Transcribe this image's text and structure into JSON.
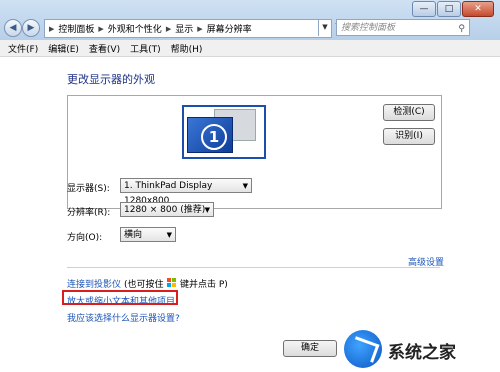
{
  "window": {
    "controls": {
      "minimize": "—",
      "maximize": "□",
      "close": "✕"
    }
  },
  "nav": {
    "back": "◀",
    "forward": "▶"
  },
  "address": {
    "segments": [
      "控制面板",
      "外观和个性化",
      "显示",
      "屏幕分辨率"
    ],
    "separator": "▶",
    "refresh_icon": "↻"
  },
  "search": {
    "placeholder": "搜索控制面板",
    "icon": "search-icon"
  },
  "menu": [
    "文件(F)",
    "编辑(E)",
    "查看(V)",
    "工具(T)",
    "帮助(H)"
  ],
  "page": {
    "title": "更改显示器的外观"
  },
  "preview": {
    "monitor_number": "1",
    "detect_button": "检测(C)",
    "identify_button": "识别(I)"
  },
  "settings": {
    "display": {
      "label": "显示器(S):",
      "value": "1. ThinkPad Display 1280x800"
    },
    "resolution": {
      "label": "分辨率(R):",
      "value": "1280 × 800 (推荐)"
    },
    "orientation": {
      "label": "方向(O):",
      "value": "横向"
    }
  },
  "links": {
    "advanced": "高级设置",
    "projector": "连接到投影仪",
    "projector_hint_1": "(也可按住",
    "projector_hint_2": "键并点击 P)",
    "text_size": "放大或缩小文本和其他项目",
    "which_settings": "我应该选择什么显示器设置?"
  },
  "footer": {
    "ok_button": "确定"
  },
  "watermark": {
    "text": "系统之家"
  },
  "colors": {
    "link": "#1c55b8",
    "title": "#1e3287",
    "highlight": "#d81e1e"
  }
}
